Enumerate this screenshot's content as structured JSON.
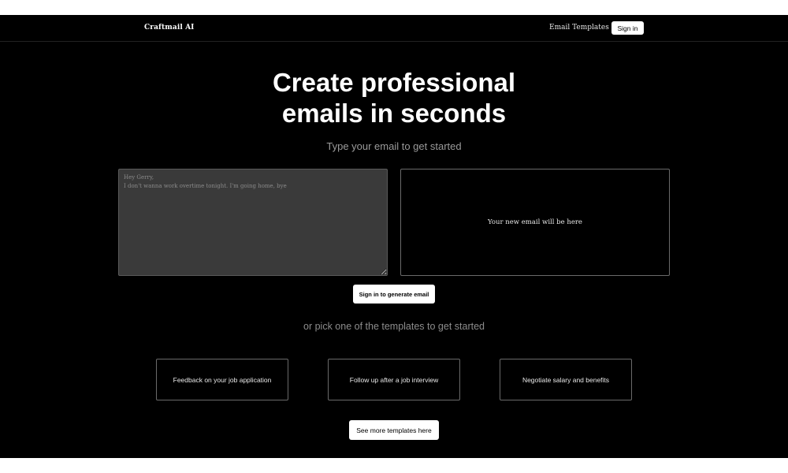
{
  "nav": {
    "brand": "Craftmail AI",
    "templates_link": "Email Templates",
    "signin_label": "Sign in"
  },
  "hero": {
    "title_line1": "Create professional",
    "title_line2": "emails in seconds",
    "subtitle": "Type your email to get started"
  },
  "editor": {
    "input_placeholder": "Hey Gerry,\nI don't wanna work overtime tonight. I'm going home, bye",
    "input_value": "",
    "output_placeholder": "Your new email will be here",
    "generate_label": "Sign in to generate email"
  },
  "templates": {
    "heading": "or pick one of the templates to get started",
    "items": [
      {
        "label": "Feedback on your job application"
      },
      {
        "label": "Follow up after a job interview"
      },
      {
        "label": "Negotiate salary and benefits"
      }
    ],
    "more_label": "See more templates here"
  },
  "colors": {
    "background": "#000000",
    "surface_input": "#3a3a3a",
    "border": "#6a6a6a",
    "button_bg": "#ffffff",
    "muted_text": "#9a9a9a"
  }
}
